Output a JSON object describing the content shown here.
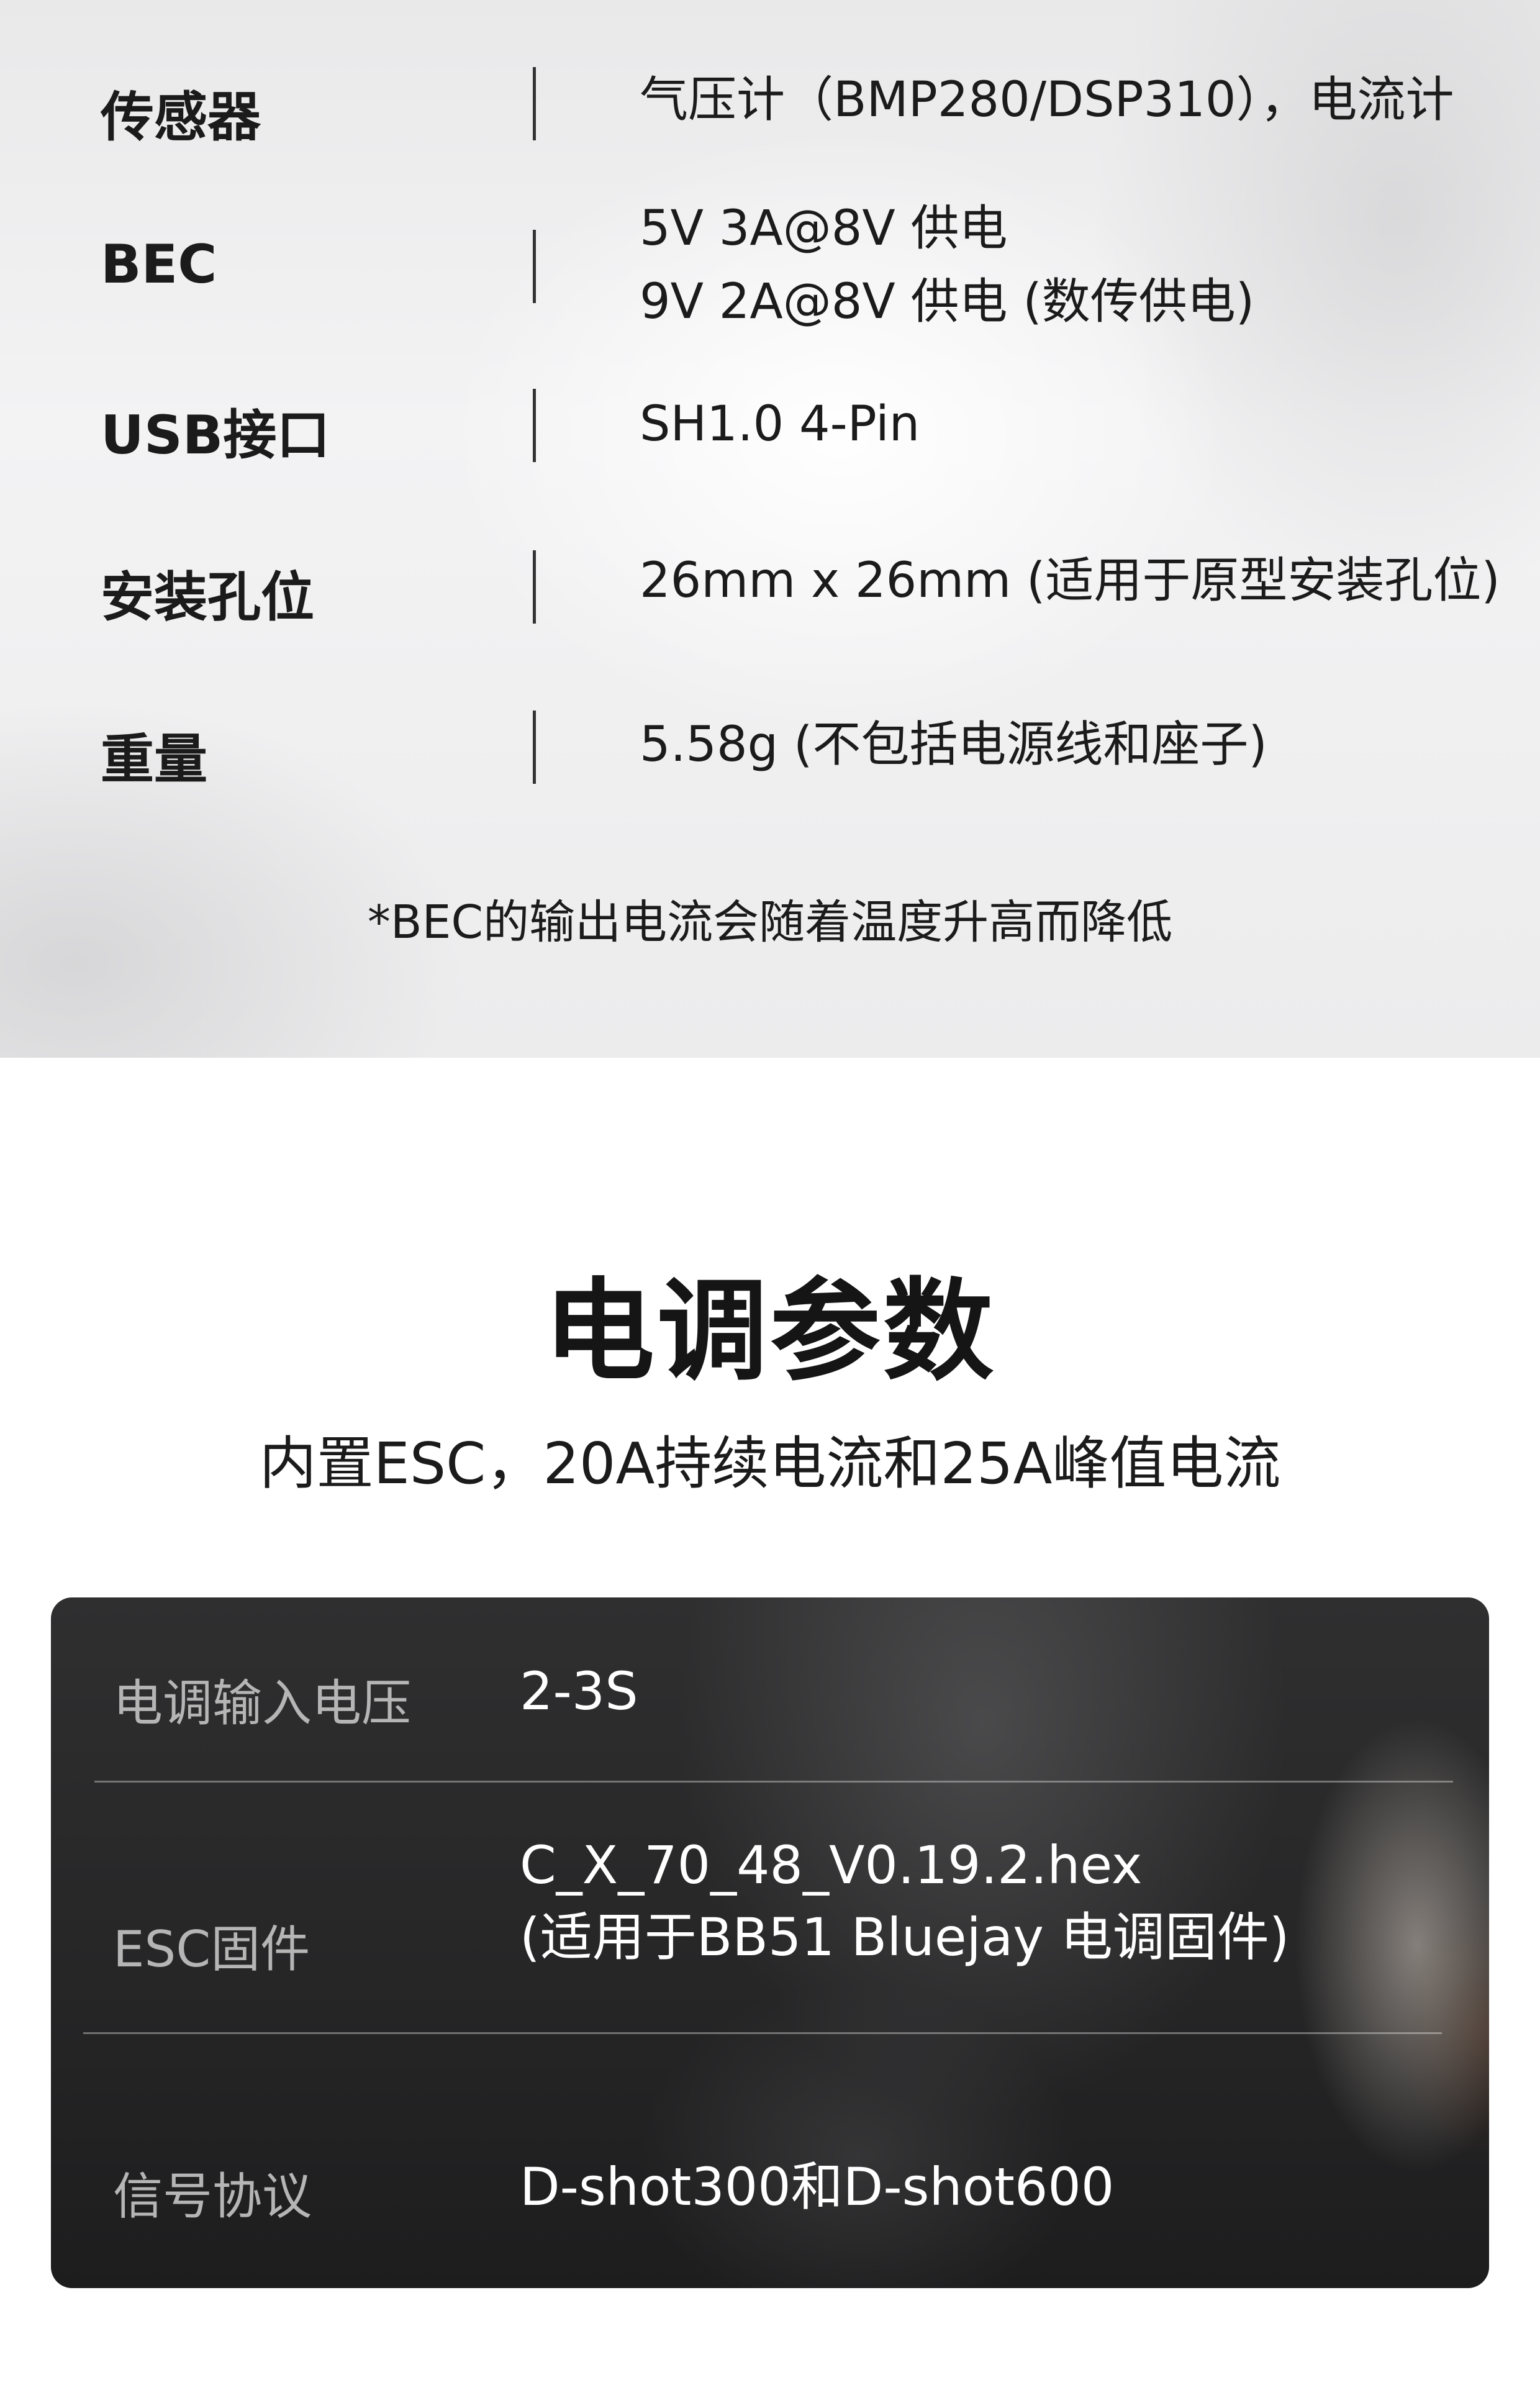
{
  "specs": [
    {
      "label": "传感器",
      "value_lines": [
        "气压计（BMP280/DSP310），电流计"
      ]
    },
    {
      "label": "BEC",
      "value_lines": [
        "5V 3A@8V 供电",
        "9V 2A@8V 供电 (数传供电)"
      ]
    },
    {
      "label": "USB接口",
      "value_lines": [
        "SH1.0 4-Pin"
      ]
    },
    {
      "label": "安装孔位",
      "value_lines": [
        "26mm x 26mm (适用于原型安装孔位)"
      ]
    },
    {
      "label": "重量",
      "value_lines": [
        "5.58g (不包括电源线和座子)"
      ]
    }
  ],
  "spec_note": "*BEC的输出电流会随着温度升高而降低",
  "esc_section": {
    "title": "电调参数",
    "subtitle": "内置ESC，20A持续电流和25A峰值电流",
    "rows": [
      {
        "label": "电调输入电压",
        "value_lines": [
          "2-3S"
        ]
      },
      {
        "label": "ESC固件",
        "value_lines": [
          "C_X_70_48_V0.19.2.hex",
          "(适用于BB51 Bluejay 电调固件)"
        ]
      },
      {
        "label": "信号协议",
        "value_lines": [
          "D-shot300和D-shot600"
        ]
      }
    ]
  }
}
